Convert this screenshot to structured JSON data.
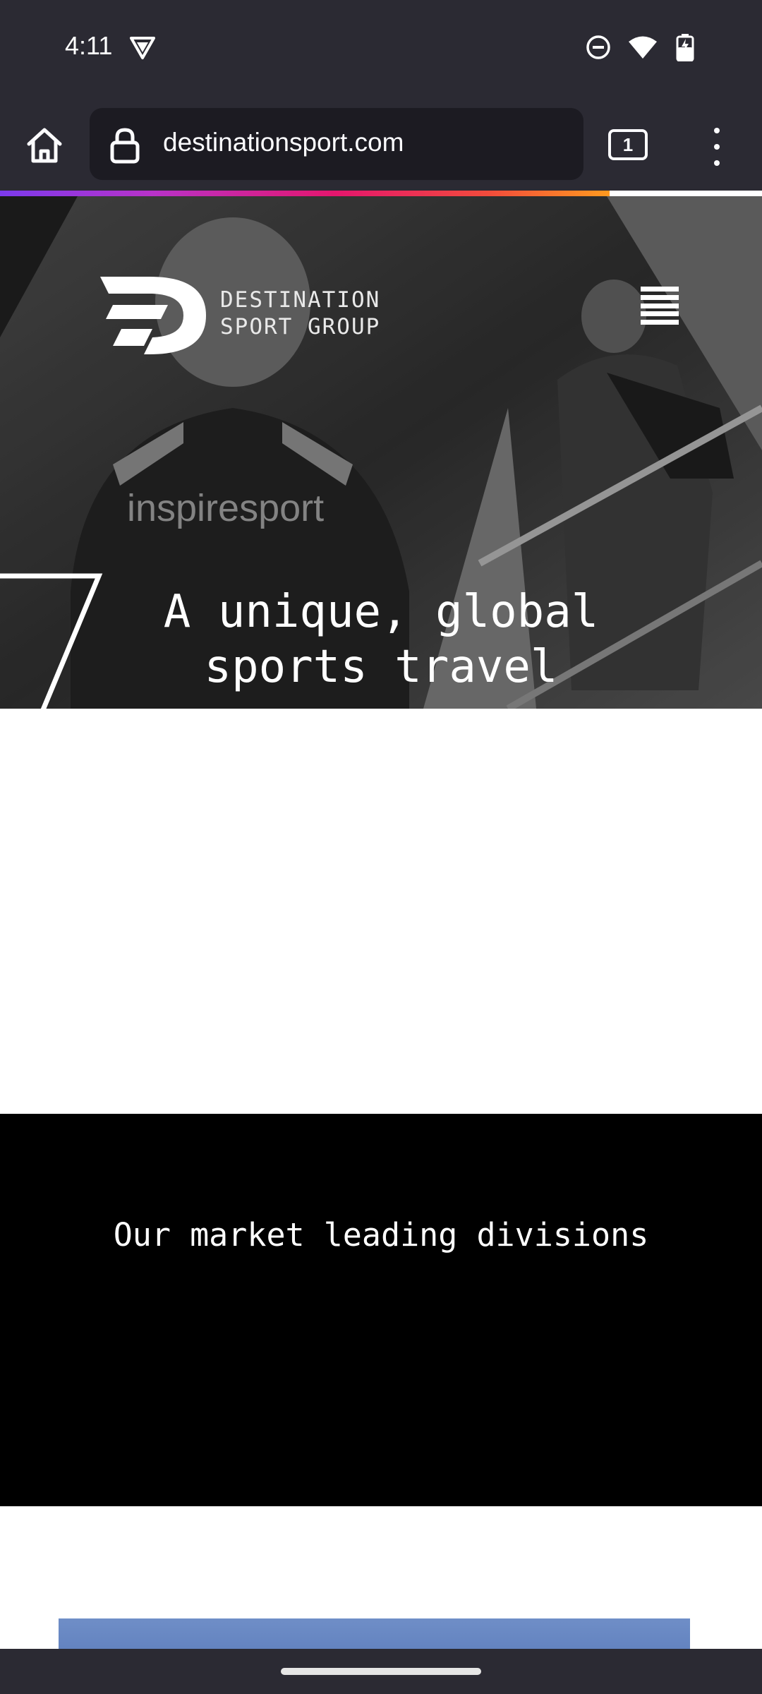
{
  "status_bar": {
    "time": "4:11",
    "icons": [
      "vpn-shield-icon",
      "do-not-disturb-icon",
      "wifi-icon",
      "battery-charging-icon"
    ]
  },
  "browser": {
    "url": "destinationsport.com",
    "tab_count": "1",
    "page_load_progress": 0.8
  },
  "hero": {
    "logo_line1": "DESTINATION",
    "logo_line2": "SPORT GROUP",
    "headline_line1": "A unique, global",
    "headline_line2": "sports travel"
  },
  "divisions": {
    "heading": "Our market leading divisions"
  },
  "colors": {
    "browser_chrome": "#2b2a33",
    "url_bar": "#1c1b22",
    "divisions_background": "#000000",
    "card_blue": "#6f8ec7"
  }
}
